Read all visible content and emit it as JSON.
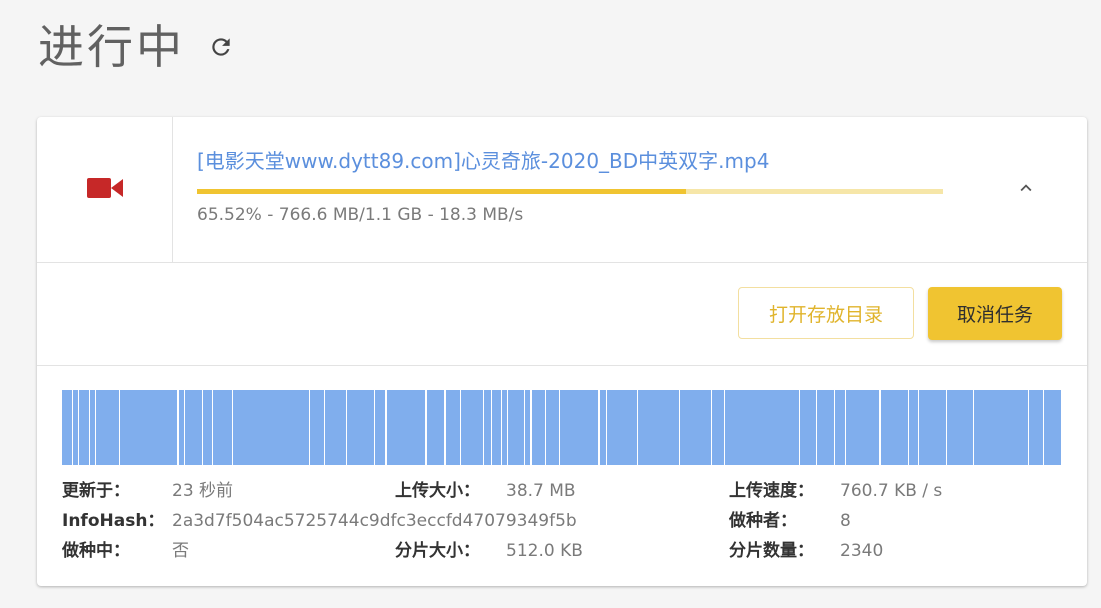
{
  "header": {
    "title": "进行中",
    "refresh_icon": "refresh-icon"
  },
  "task": {
    "file_type_icon": "video-camera-icon",
    "file_type_color": "#c62828",
    "name": "[电影天堂www.dytt89.com]心灵奇旅-2020_BD中英双字.mp4",
    "progress": 0.6552,
    "status": "65.52% - 766.6 MB/1.1 GB - 18.3 MB/s",
    "collapse_icon": "chevron-up-icon",
    "progress_color": "#f0c431",
    "progress_track_color": "#f6e6a8",
    "name_color": "#5b8fdd"
  },
  "actions": {
    "open_folder_label": "打开存放目录",
    "cancel_label": "取消任务"
  },
  "details": {
    "piece_map_color": "#80aeed",
    "updated_label": "更新于：",
    "updated_value": "23 秒前",
    "upload_size_label": "上传大小：",
    "upload_size_value": "38.7 MB",
    "upload_speed_label": "上传速度：",
    "upload_speed_value": "760.7 KB / s",
    "infohash_label": "InfoHash：",
    "infohash_value": "2a3d7f504ac5725744c9dfc3eccfd47079349f5b",
    "seeders_label": "做种者：",
    "seeders_value": "8",
    "seeding_label": "做种中：",
    "seeding_value": "否",
    "piece_size_label": "分片大小：",
    "piece_size_value": "512.0 KB",
    "piece_count_label": "分片数量：",
    "piece_count_value": "2340"
  }
}
